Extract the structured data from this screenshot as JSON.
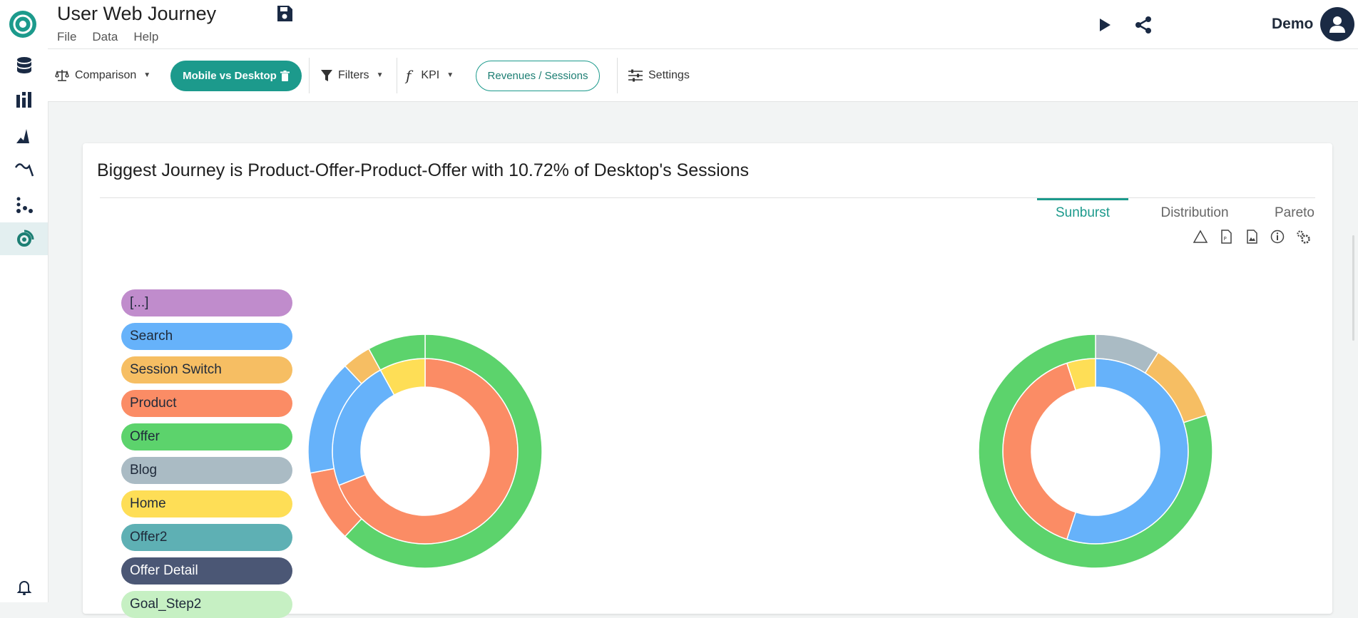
{
  "app": {
    "title": "User Web Journey",
    "menu": [
      "File",
      "Data",
      "Help"
    ],
    "user_name": "Demo"
  },
  "sidebar": {
    "icons": [
      "database-icon",
      "bar-chart-icon",
      "histogram-icon",
      "trend-line-icon",
      "scatter-icon",
      "sunburst-icon"
    ],
    "active": "sunburst-icon",
    "bottom_icon": "bell-icon"
  },
  "toolbar": {
    "comparison_label": "Comparison",
    "comparison_value": "Mobile vs Desktop",
    "filters_label": "Filters",
    "kpi_label": "KPI",
    "kpi_value": "Revenues / Sessions",
    "settings_label": "Settings"
  },
  "card": {
    "title": "Biggest Journey is Product-Offer-Product-Offer with 10.72% of Desktop's Sessions",
    "tabs": [
      "Sunburst",
      "Distribution",
      "Pareto"
    ],
    "active_tab": "Sunburst",
    "tool_icons": [
      "warning-icon",
      "pdf-icon",
      "image-icon",
      "info-icon",
      "gears-icon"
    ]
  },
  "legend": [
    {
      "label": "[...]",
      "color": "#c08ccc"
    },
    {
      "label": "Search",
      "color": "#66b2fa"
    },
    {
      "label": "Session Switch",
      "color": "#f6be63"
    },
    {
      "label": "Product",
      "color": "#fb8c65"
    },
    {
      "label": "Offer",
      "color": "#5cd36c"
    },
    {
      "label": "Blog",
      "color": "#aabbc4"
    },
    {
      "label": "Home",
      "color": "#fede56"
    },
    {
      "label": "Offer2",
      "color": "#5eb0b4"
    },
    {
      "label": "Offer Detail",
      "color": "#4b5775"
    },
    {
      "label": "Goal_Step2",
      "color": "#c6f0c3"
    }
  ],
  "colors": {
    "accent": "#1c9a8c",
    "extra_pink": "#f7aef0",
    "black_segment": "#050505"
  },
  "chart_data": [
    {
      "type": "sunburst",
      "name": "Mobile",
      "levels": [
        [
          {
            "label": "Product",
            "share": 0.69
          },
          {
            "label": "Search",
            "share": 0.23
          },
          {
            "label": "Home",
            "share": 0.08
          }
        ],
        [
          {
            "label": "Offer",
            "share": 0.62
          },
          {
            "label": "Product",
            "share": 0.1
          },
          {
            "label": "Search",
            "share": 0.16
          },
          {
            "label": "Session Switch",
            "share": 0.04
          },
          {
            "label": "Offer",
            "share": 0.08
          }
        ]
      ]
    },
    {
      "type": "sunburst",
      "name": "Desktop",
      "levels": [
        [
          {
            "label": "Search",
            "share": 0.55
          },
          {
            "label": "Product",
            "share": 0.4
          },
          {
            "label": "Home",
            "share": 0.05
          }
        ],
        [
          {
            "label": "Blog",
            "share": 0.09
          },
          {
            "label": "Session Switch",
            "share": 0.11
          },
          {
            "label": "Offer",
            "share": 0.8
          }
        ]
      ]
    }
  ]
}
